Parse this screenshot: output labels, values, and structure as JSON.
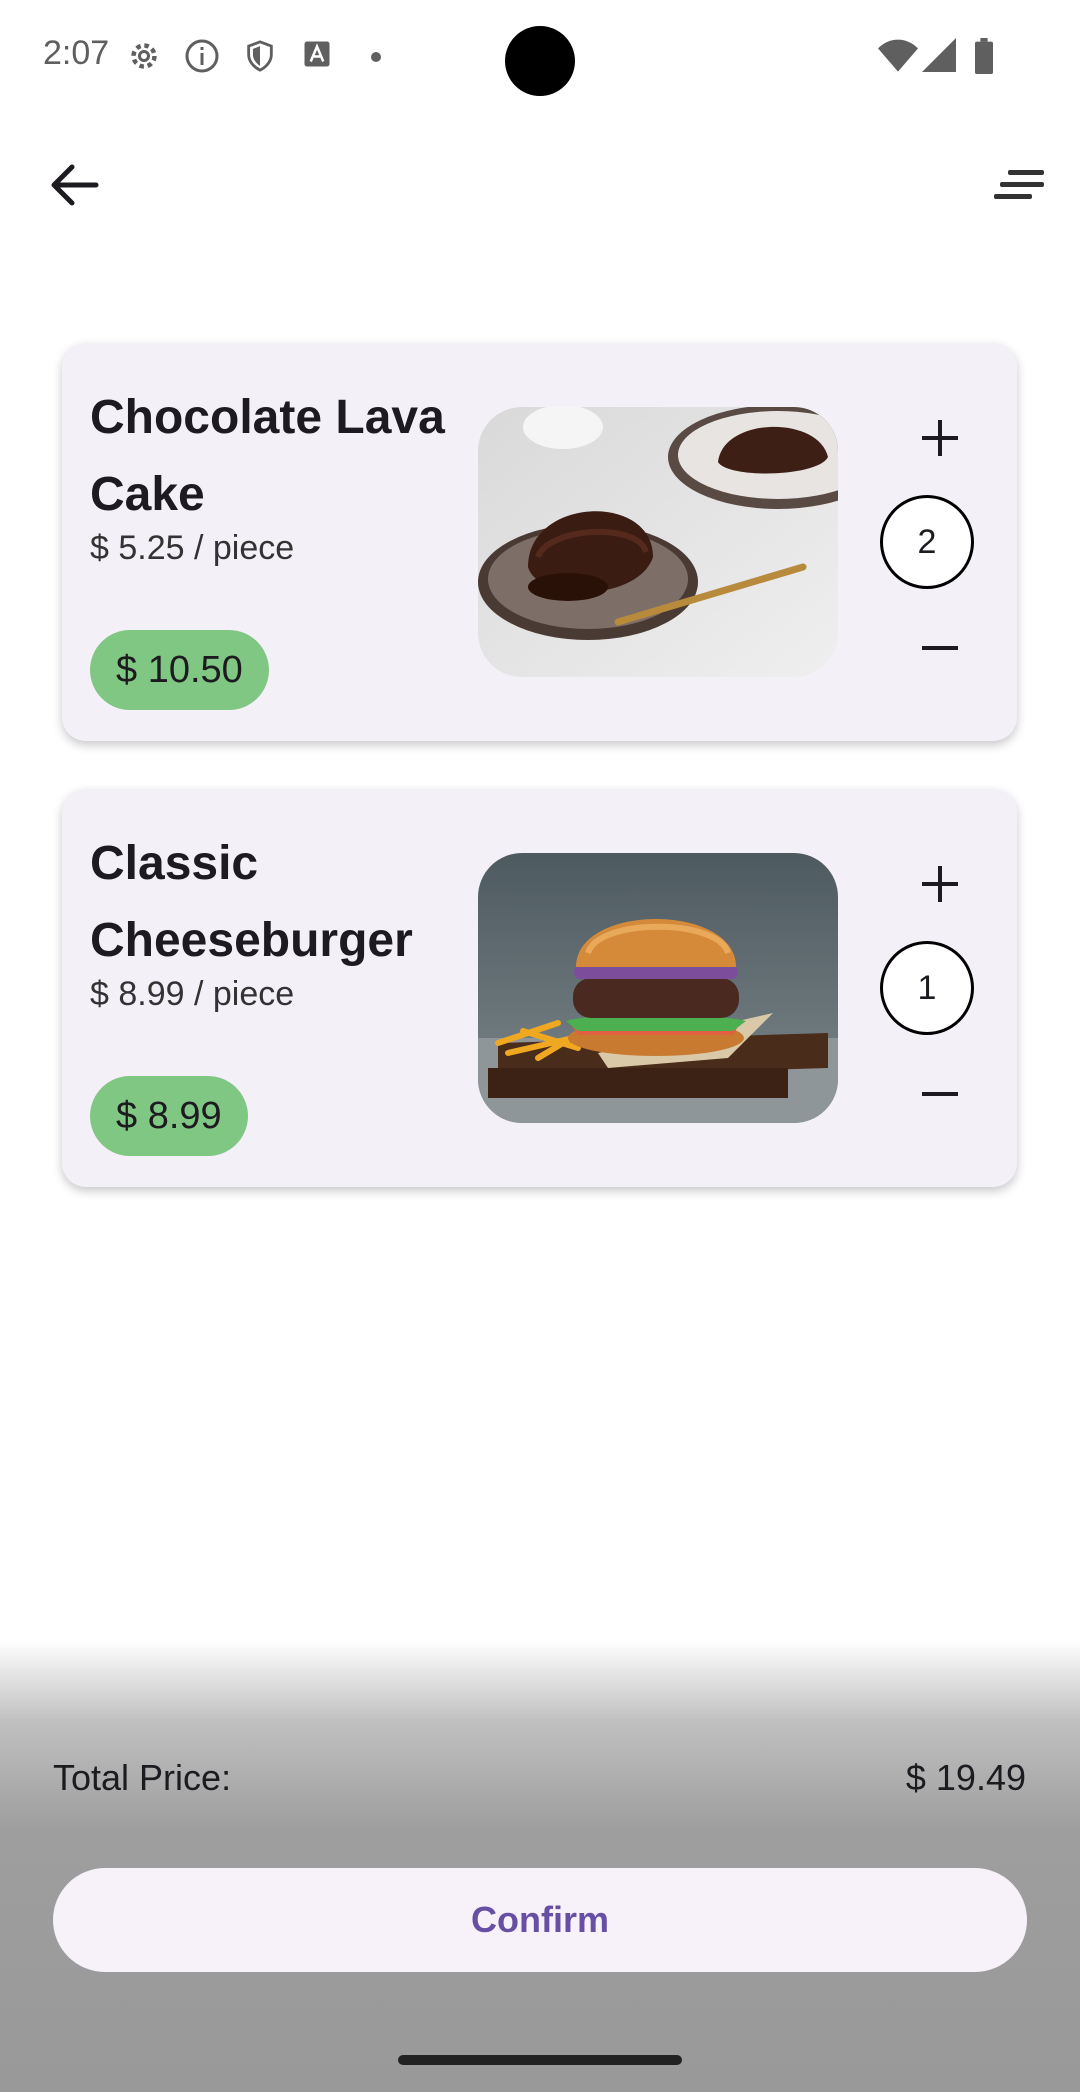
{
  "status_bar": {
    "time": "2:07",
    "icons": [
      "gear-icon",
      "info-icon",
      "shield-icon",
      "font-a-icon",
      "dot-icon",
      "wifi-icon",
      "signal-icon",
      "battery-icon"
    ]
  },
  "app_bar": {
    "back_icon": "arrow-left-icon",
    "menu_icon": "sort-lines-icon"
  },
  "cart": {
    "items": [
      {
        "name": "Chocolate Lava Cake",
        "unit_price": "$ 5.25 / piece",
        "total": "$ 10.50",
        "quantity": "2",
        "image": "chocolate-lava-cake-photo"
      },
      {
        "name": "Classic Cheeseburger",
        "unit_price": "$ 8.99 / piece",
        "total": "$ 8.99",
        "quantity": "1",
        "image": "cheeseburger-photo"
      }
    ]
  },
  "summary": {
    "total_label": "Total Price:",
    "total_value": "$ 19.49",
    "confirm_label": "Confirm"
  },
  "colors": {
    "card_bg": "#f4f0f8",
    "price_chip": "#81c784",
    "primary": "#6750a4"
  }
}
